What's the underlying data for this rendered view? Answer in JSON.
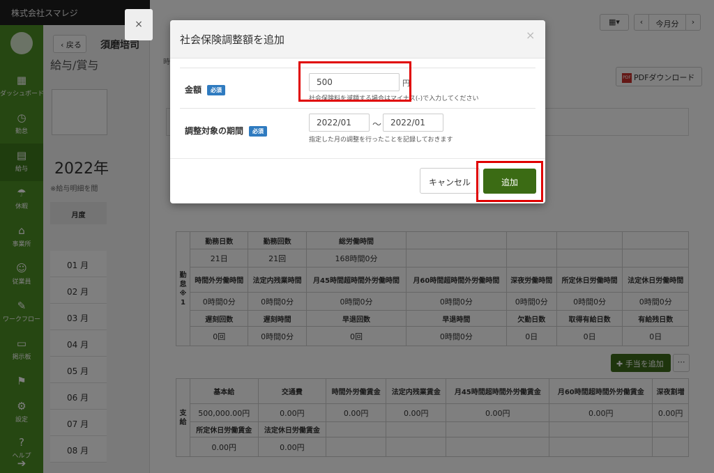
{
  "header": {
    "company": "株式会社スマレジ"
  },
  "sidebar": {
    "items": [
      {
        "label": "ダッシュボード",
        "icon": "dashboard-icon"
      },
      {
        "label": "勤怠",
        "icon": "clock-icon"
      },
      {
        "label": "給与",
        "icon": "calculator-icon"
      },
      {
        "label": "休暇",
        "icon": "vacation-icon"
      },
      {
        "label": "事業所",
        "icon": "home-icon"
      },
      {
        "label": "従業員",
        "icon": "person-icon"
      },
      {
        "label": "ワークフロー",
        "icon": "workflow-icon"
      },
      {
        "label": "掲示板",
        "icon": "chat-icon"
      },
      {
        "label": "設定",
        "icon": "gear-icon"
      },
      {
        "label": "ヘルプ",
        "icon": "help-icon"
      }
    ]
  },
  "subpanel": {
    "back_label": "戻る",
    "employee_name": "須磨培司",
    "section_title": "給与/賞与",
    "year_title": "2022年",
    "note": "※給与明細を閲",
    "month_head": "月度",
    "months": [
      "01 月",
      "02 月",
      "03 月",
      "04 月",
      "05 月",
      "06 月",
      "07 月",
      "08 月"
    ]
  },
  "toolbar": {
    "month_label": "今月分",
    "pdf_label": "PDFダウンロード",
    "pdf_icon_text": "PDF",
    "cut_label": "時",
    "add_allowance_label": "手当を追加",
    "more_label": "⋯"
  },
  "attendance": {
    "side_label": "勤怠※1",
    "rows": [
      [
        "勤務日数",
        "勤務回数",
        "総労働時間",
        "",
        "",
        "",
        ""
      ],
      [
        "21日",
        "21回",
        "168時間0分",
        "",
        "",
        "",
        ""
      ],
      [
        "時間外労働時間",
        "法定内残業時間",
        "月45時間超時間外労働時間",
        "月60時間超時間外労働時間",
        "深夜労働時間",
        "所定休日労働時間",
        "法定休日労働時間"
      ],
      [
        "0時間0分",
        "0時間0分",
        "0時間0分",
        "0時間0分",
        "0時間0分",
        "0時間0分",
        "0時間0分"
      ],
      [
        "遅刻回数",
        "遅刻時間",
        "早退回数",
        "早退時間",
        "欠勤日数",
        "取得有給日数",
        "有給残日数"
      ],
      [
        "0回",
        "0時間0分",
        "0回",
        "0時間0分",
        "0日",
        "0日",
        "0日"
      ]
    ]
  },
  "payment": {
    "side_label": "支給",
    "rows": [
      [
        "基本給",
        "交通費",
        "時間外労働賃金",
        "法定内残業賃金",
        "月45時間超時間外労働賃金",
        "月60時間超時間外労働賃金",
        "深夜割増"
      ],
      [
        "500,000.00円",
        "0.00円",
        "0.00円",
        "0.00円",
        "0.00円",
        "0.00円",
        "0.00円"
      ],
      [
        "所定休日労働賃金",
        "法定休日労働賃金",
        "",
        "",
        "",
        "",
        ""
      ],
      [
        "0.00円",
        "0.00円",
        "",
        "",
        "",
        "",
        ""
      ]
    ]
  },
  "modal": {
    "title": "社会保険調整額を追加",
    "close": "×",
    "amount": {
      "label": "金額",
      "required": "必須",
      "value": "500",
      "unit": "円",
      "hint": "社会保険料を減額する場合はマイナス(-)で入力してください"
    },
    "period": {
      "label": "調整対象の期間",
      "required": "必須",
      "from": "2022/01",
      "to": "2022/01",
      "separator": "〜",
      "hint": "指定した月の調整を行ったことを記録しておきます"
    },
    "cancel_label": "キャンセル",
    "add_label": "追加"
  },
  "ghost_close": "×",
  "colors": {
    "brand_green": "#4d8f24",
    "primary_button": "#3b6b14",
    "badge_blue": "#2f7bc0",
    "highlight_red": "#e00000"
  }
}
